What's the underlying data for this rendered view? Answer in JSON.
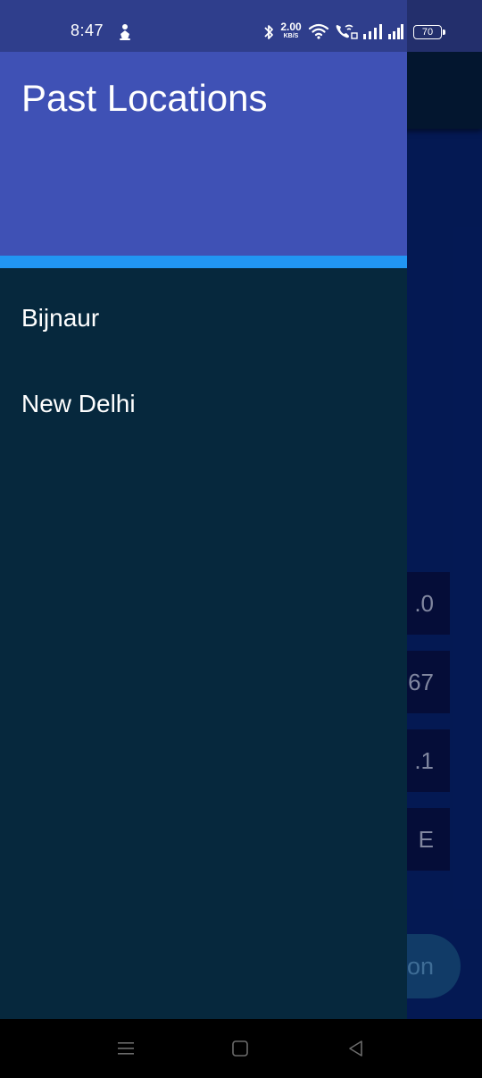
{
  "status_bar": {
    "time": "8:47",
    "net_speed_value": "2.00",
    "net_speed_unit": "KB/S",
    "battery": "70",
    "icons": [
      "notification-icon",
      "bluetooth-icon",
      "wifi-icon",
      "wifi-call-icon",
      "signal-icon",
      "signal-icon"
    ]
  },
  "background": {
    "stats": [
      ".0",
      "67",
      ".1",
      "E"
    ],
    "fab_label": "on"
  },
  "drawer": {
    "title": "Past Locations",
    "items": [
      {
        "label": "Bijnaur"
      },
      {
        "label": "New Delhi"
      }
    ]
  },
  "nav_bar": {
    "icons": [
      "recents-menu-icon",
      "home-icon",
      "back-icon"
    ]
  },
  "colors": {
    "drawer_header": "#3f51b5",
    "accent_bar": "#2196f3",
    "drawer_body": "#06283d",
    "status_bar": "#2f3e8c"
  }
}
